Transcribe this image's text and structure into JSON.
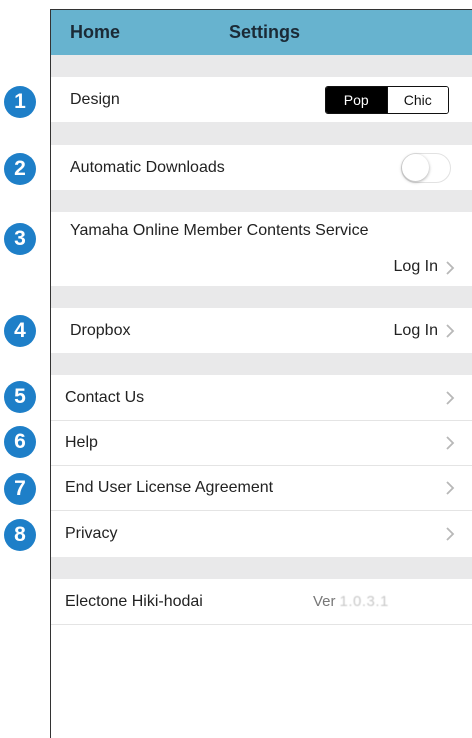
{
  "callouts": [
    "1",
    "2",
    "3",
    "4",
    "5",
    "6",
    "7",
    "8"
  ],
  "navbar": {
    "home_label": "Home",
    "title": "Settings"
  },
  "design": {
    "label": "Design",
    "options": [
      "Pop",
      "Chic"
    ],
    "selected": "Pop"
  },
  "automatic_downloads": {
    "label": "Automatic Downloads",
    "enabled": false
  },
  "yamaha_service": {
    "label": "Yamaha Online Member Contents Service",
    "action": "Log In"
  },
  "dropbox": {
    "label": "Dropbox",
    "action": "Log In"
  },
  "menu": {
    "contact_us": "Contact Us",
    "help": "Help",
    "eula": "End User License Agreement",
    "privacy": "Privacy"
  },
  "app_info": {
    "name": "Electone Hiki-hodai",
    "version_prefix": "Ver",
    "version": "1.0.3.1"
  },
  "colors": {
    "navbar": "#67b3cf",
    "callout": "#1e7fc8",
    "section_gap": "#e9e9ea"
  },
  "icons": {
    "chevron": "chevron-right-icon"
  }
}
